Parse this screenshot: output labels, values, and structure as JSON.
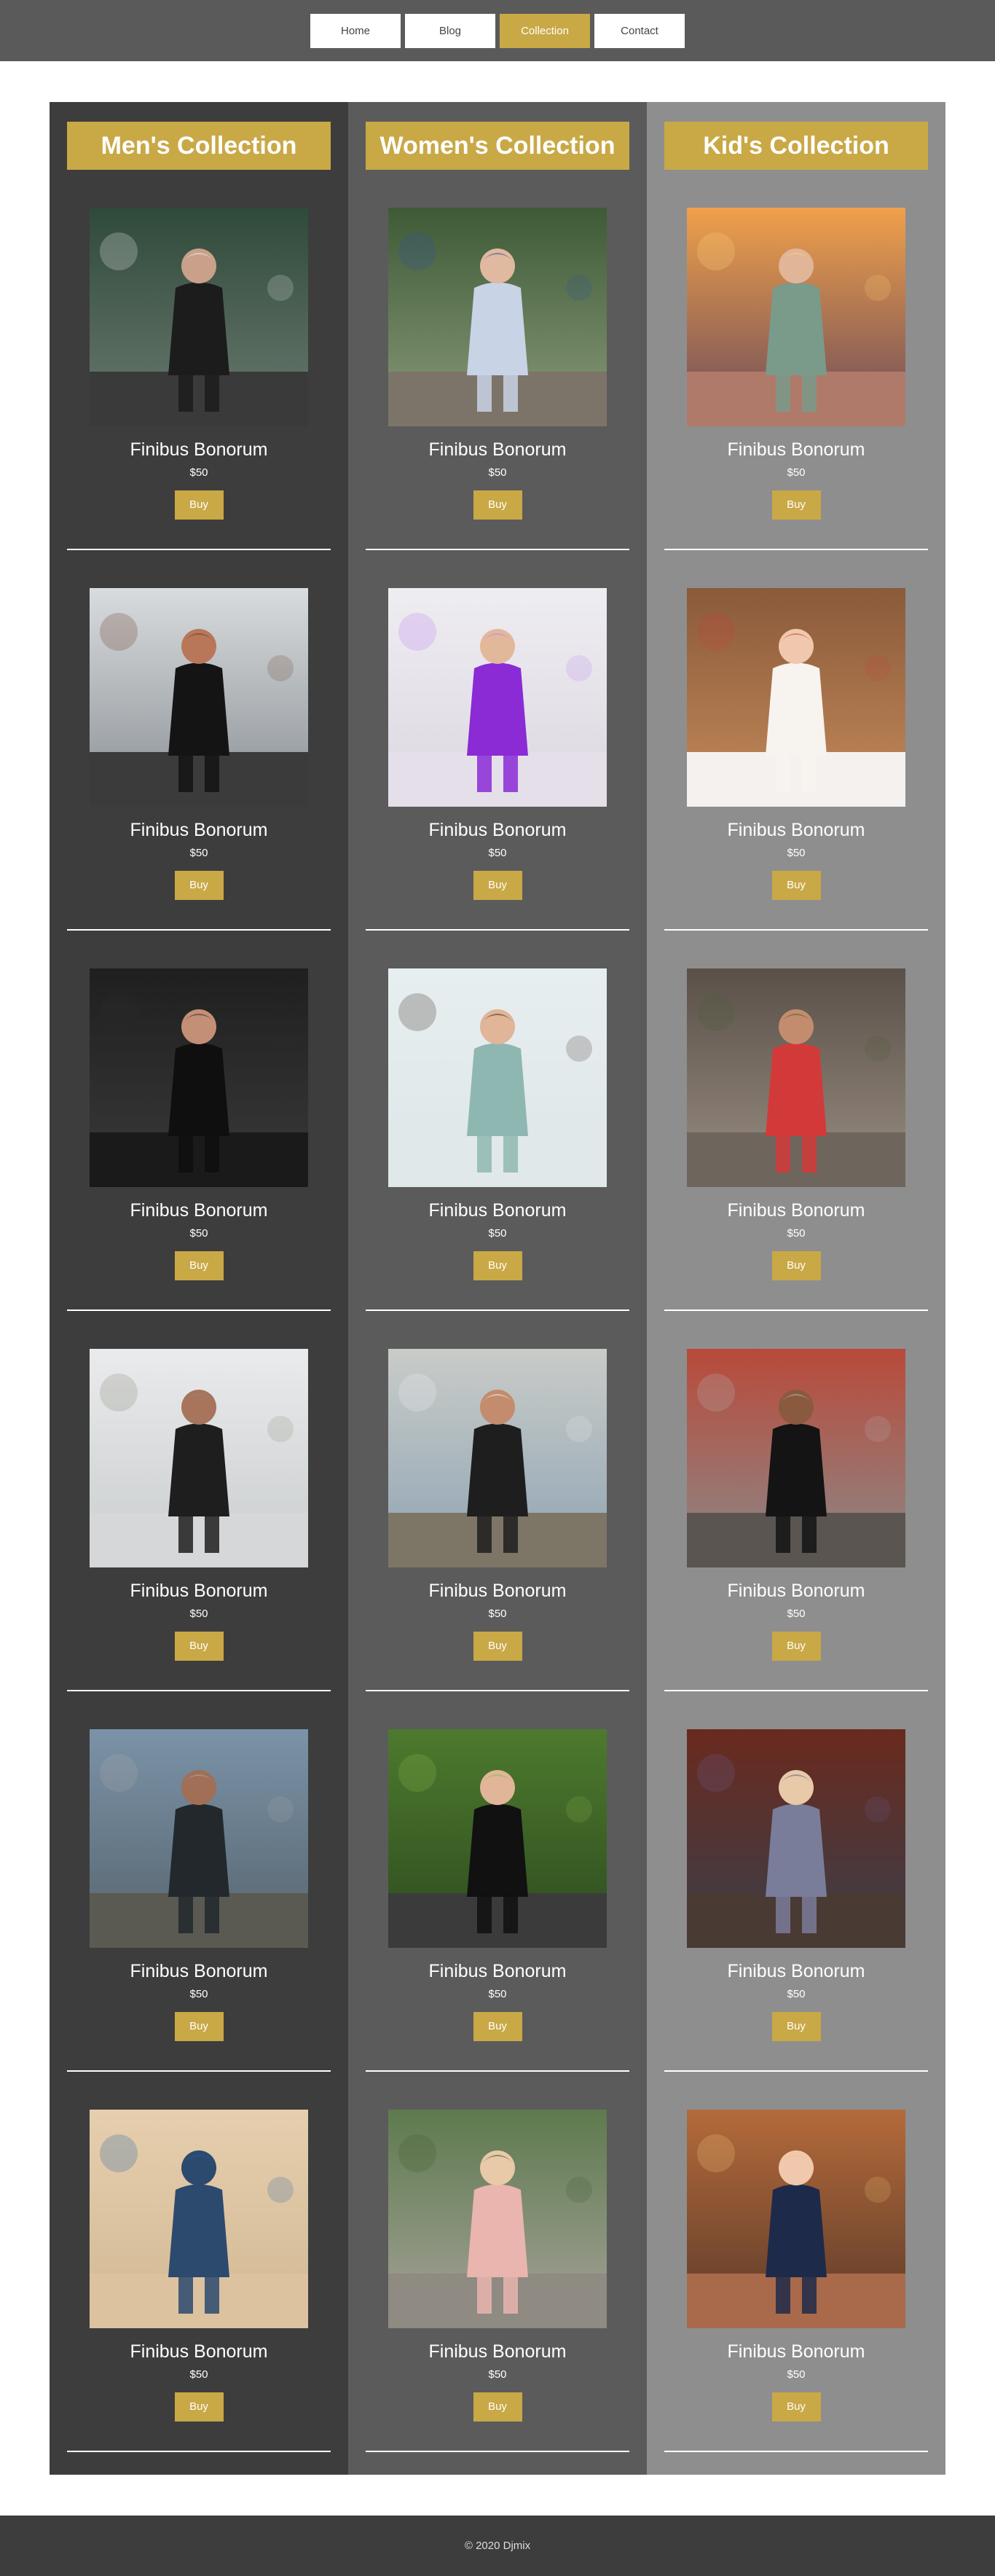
{
  "nav": {
    "items": [
      {
        "label": "Home",
        "active": false
      },
      {
        "label": "Blog",
        "active": false
      },
      {
        "label": "Collection",
        "active": true
      },
      {
        "label": "Contact",
        "active": false
      }
    ]
  },
  "colors": {
    "accent": "#c9a846",
    "header_bg": "#5a5a5a",
    "footer_bg": "#3d3d3d",
    "column_backgrounds": [
      "#3d3d3d",
      "#5b5b5b",
      "#8e8e8e"
    ]
  },
  "collections": [
    {
      "title": "Men's Collection",
      "products": [
        {
          "name": "Finibus Bonorum",
          "price": "$50",
          "button": "Buy",
          "image": "man-leather-jacket-forest-road-photo"
        },
        {
          "name": "Finibus Bonorum",
          "price": "$50",
          "button": "Buy",
          "image": "bearded-man-black-sweater-photo"
        },
        {
          "name": "Finibus Bonorum",
          "price": "$50",
          "button": "Buy",
          "image": "man-black-vneck-holding-jacket-photo"
        },
        {
          "name": "Finibus Bonorum",
          "price": "$50",
          "button": "Buy",
          "image": "man-jumping-with-shadow-photo"
        },
        {
          "name": "Finibus Bonorum",
          "price": "$50",
          "button": "Buy",
          "image": "man-on-motorcycle-photo"
        },
        {
          "name": "Finibus Bonorum",
          "price": "$50",
          "button": "Buy",
          "image": "man-jeans-on-sand-photo"
        }
      ]
    },
    {
      "title": "Women's Collection",
      "products": [
        {
          "name": "Finibus Bonorum",
          "price": "$50",
          "button": "Buy",
          "image": "woman-floral-dress-boardwalk-photo"
        },
        {
          "name": "Finibus Bonorum",
          "price": "$50",
          "button": "Buy",
          "image": "woman-purple-gown-photo"
        },
        {
          "name": "Finibus Bonorum",
          "price": "$50",
          "button": "Buy",
          "image": "woman-mint-dress-hat-photo"
        },
        {
          "name": "Finibus Bonorum",
          "price": "$50",
          "button": "Buy",
          "image": "woman-sitting-by-harbor-photo"
        },
        {
          "name": "Finibus Bonorum",
          "price": "$50",
          "button": "Buy",
          "image": "woman-black-dress-garden-path-photo"
        },
        {
          "name": "Finibus Bonorum",
          "price": "$50",
          "button": "Buy",
          "image": "woman-pink-dress-street-photo"
        }
      ]
    },
    {
      "title": "Kid's Collection",
      "products": [
        {
          "name": "Finibus Bonorum",
          "price": "$50",
          "button": "Buy",
          "image": "girl-sunset-dress-photo"
        },
        {
          "name": "Finibus Bonorum",
          "price": "$50",
          "button": "Buy",
          "image": "baby-white-bonnet-photo"
        },
        {
          "name": "Finibus Bonorum",
          "price": "$50",
          "button": "Buy",
          "image": "two-kids-cobblestone-photo"
        },
        {
          "name": "Finibus Bonorum",
          "price": "$50",
          "button": "Buy",
          "image": "mother-hugging-child-street-photo"
        },
        {
          "name": "Finibus Bonorum",
          "price": "$50",
          "button": "Buy",
          "image": "two-kids-traditional-clothes-photo"
        },
        {
          "name": "Finibus Bonorum",
          "price": "$50",
          "button": "Buy",
          "image": "girl-curly-hair-bokeh-photo"
        }
      ]
    }
  ],
  "footer": {
    "text": "© 2020 Djmix"
  }
}
